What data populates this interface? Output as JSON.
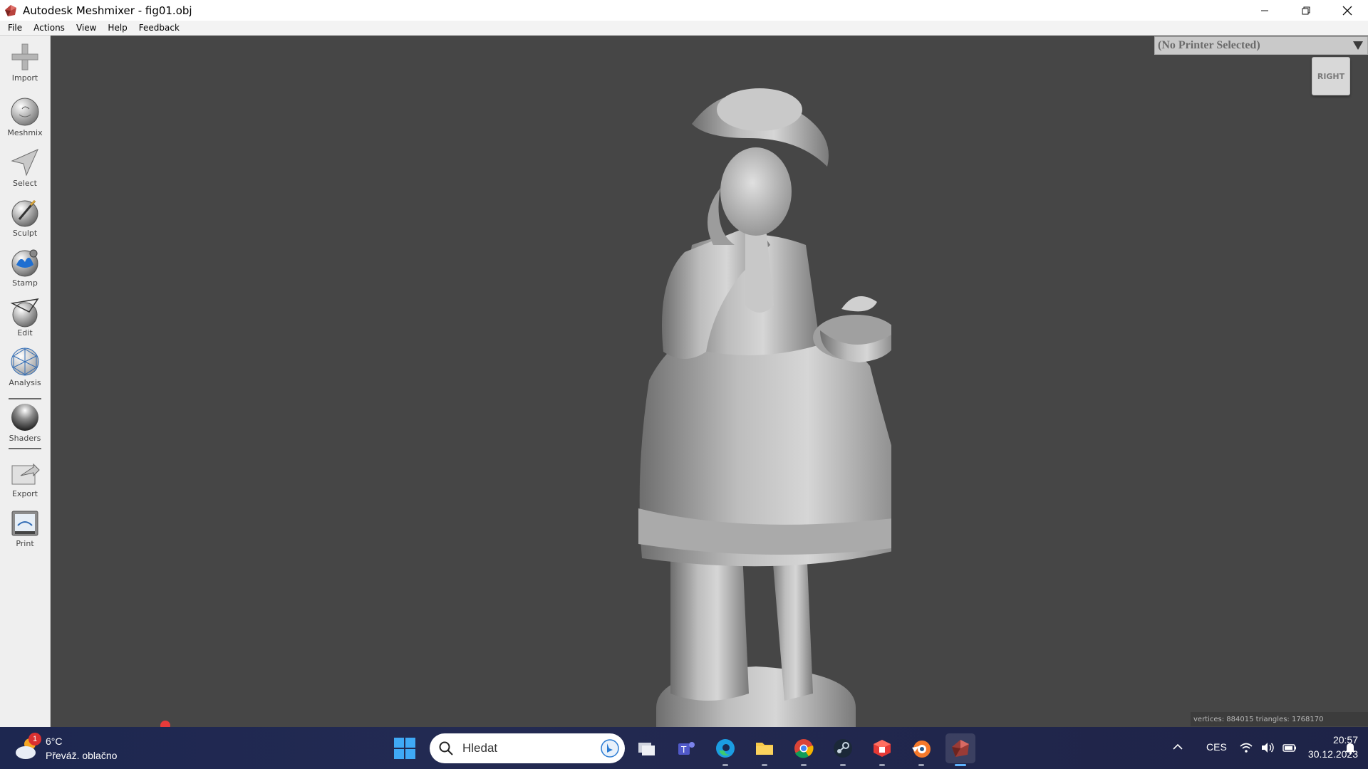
{
  "window": {
    "title": "Autodesk Meshmixer - fig01.obj"
  },
  "menu": {
    "items": [
      "File",
      "Actions",
      "View",
      "Help",
      "Feedback"
    ]
  },
  "toolbar": {
    "tools": [
      {
        "label": "Import",
        "icon": "import-icon"
      },
      {
        "label": "Meshmix",
        "icon": "meshmix-icon"
      },
      {
        "label": "Select",
        "icon": "select-icon"
      },
      {
        "label": "Sculpt",
        "icon": "sculpt-icon"
      },
      {
        "label": "Stamp",
        "icon": "stamp-icon"
      },
      {
        "label": "Edit",
        "icon": "edit-icon"
      },
      {
        "label": "Analysis",
        "icon": "analysis-icon"
      },
      {
        "label": "Shaders",
        "icon": "shaders-icon"
      },
      {
        "label": "Export",
        "icon": "export-icon"
      },
      {
        "label": "Print",
        "icon": "print-icon"
      }
    ]
  },
  "viewport": {
    "printer": "(No Printer Selected)",
    "view_cube_label": "RIGHT",
    "mesh_stats": "vertices: 884015 triangles: 1768170",
    "background_color": "#464646"
  },
  "taskbar": {
    "weather": {
      "temp": "6°C",
      "condition": "Převáž. oblačno",
      "badge": "1"
    },
    "search_placeholder": "Hledat",
    "apps": [
      "task-view",
      "teams",
      "edge",
      "file-explorer",
      "chrome",
      "steam",
      "red-app",
      "blender",
      "meshmixer"
    ],
    "tray": {
      "language": "CES",
      "time": "20:57",
      "date": "30.12.2023"
    }
  }
}
